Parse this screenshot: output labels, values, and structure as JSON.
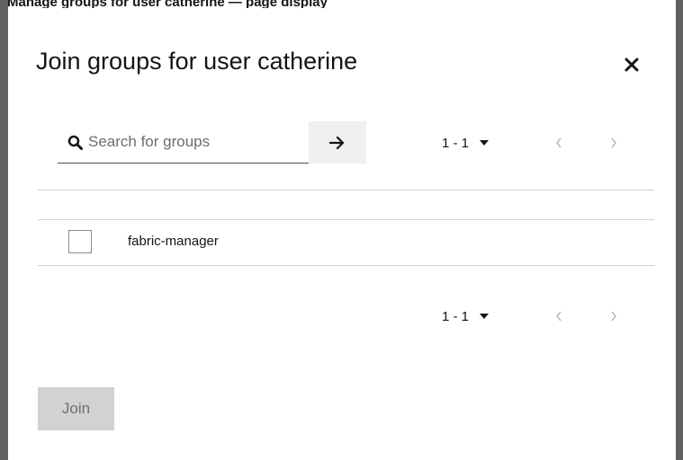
{
  "background": {
    "partial_text": "Manage groups for user catherine — page display"
  },
  "modal": {
    "title": "Join groups for user catherine",
    "close_icon": "close-icon"
  },
  "search": {
    "placeholder": "Search for groups",
    "value": "",
    "search_icon": "search-icon",
    "submit_icon": "arrow-right-icon"
  },
  "pagination_top": {
    "range": "1 - 1",
    "prev_icon": "chevron-left-icon",
    "next_icon": "chevron-right-icon"
  },
  "groups": [
    {
      "name": "fabric-manager",
      "checked": false
    }
  ],
  "pagination_bottom": {
    "range": "1 - 1",
    "prev_icon": "chevron-left-icon",
    "next_icon": "chevron-right-icon"
  },
  "footer": {
    "join_label": "Join"
  },
  "colors": {
    "backdrop_bar": "#616161",
    "text": "#151515",
    "disabled_button": "#d2d2d2",
    "disabled_text": "#6a6e73"
  }
}
